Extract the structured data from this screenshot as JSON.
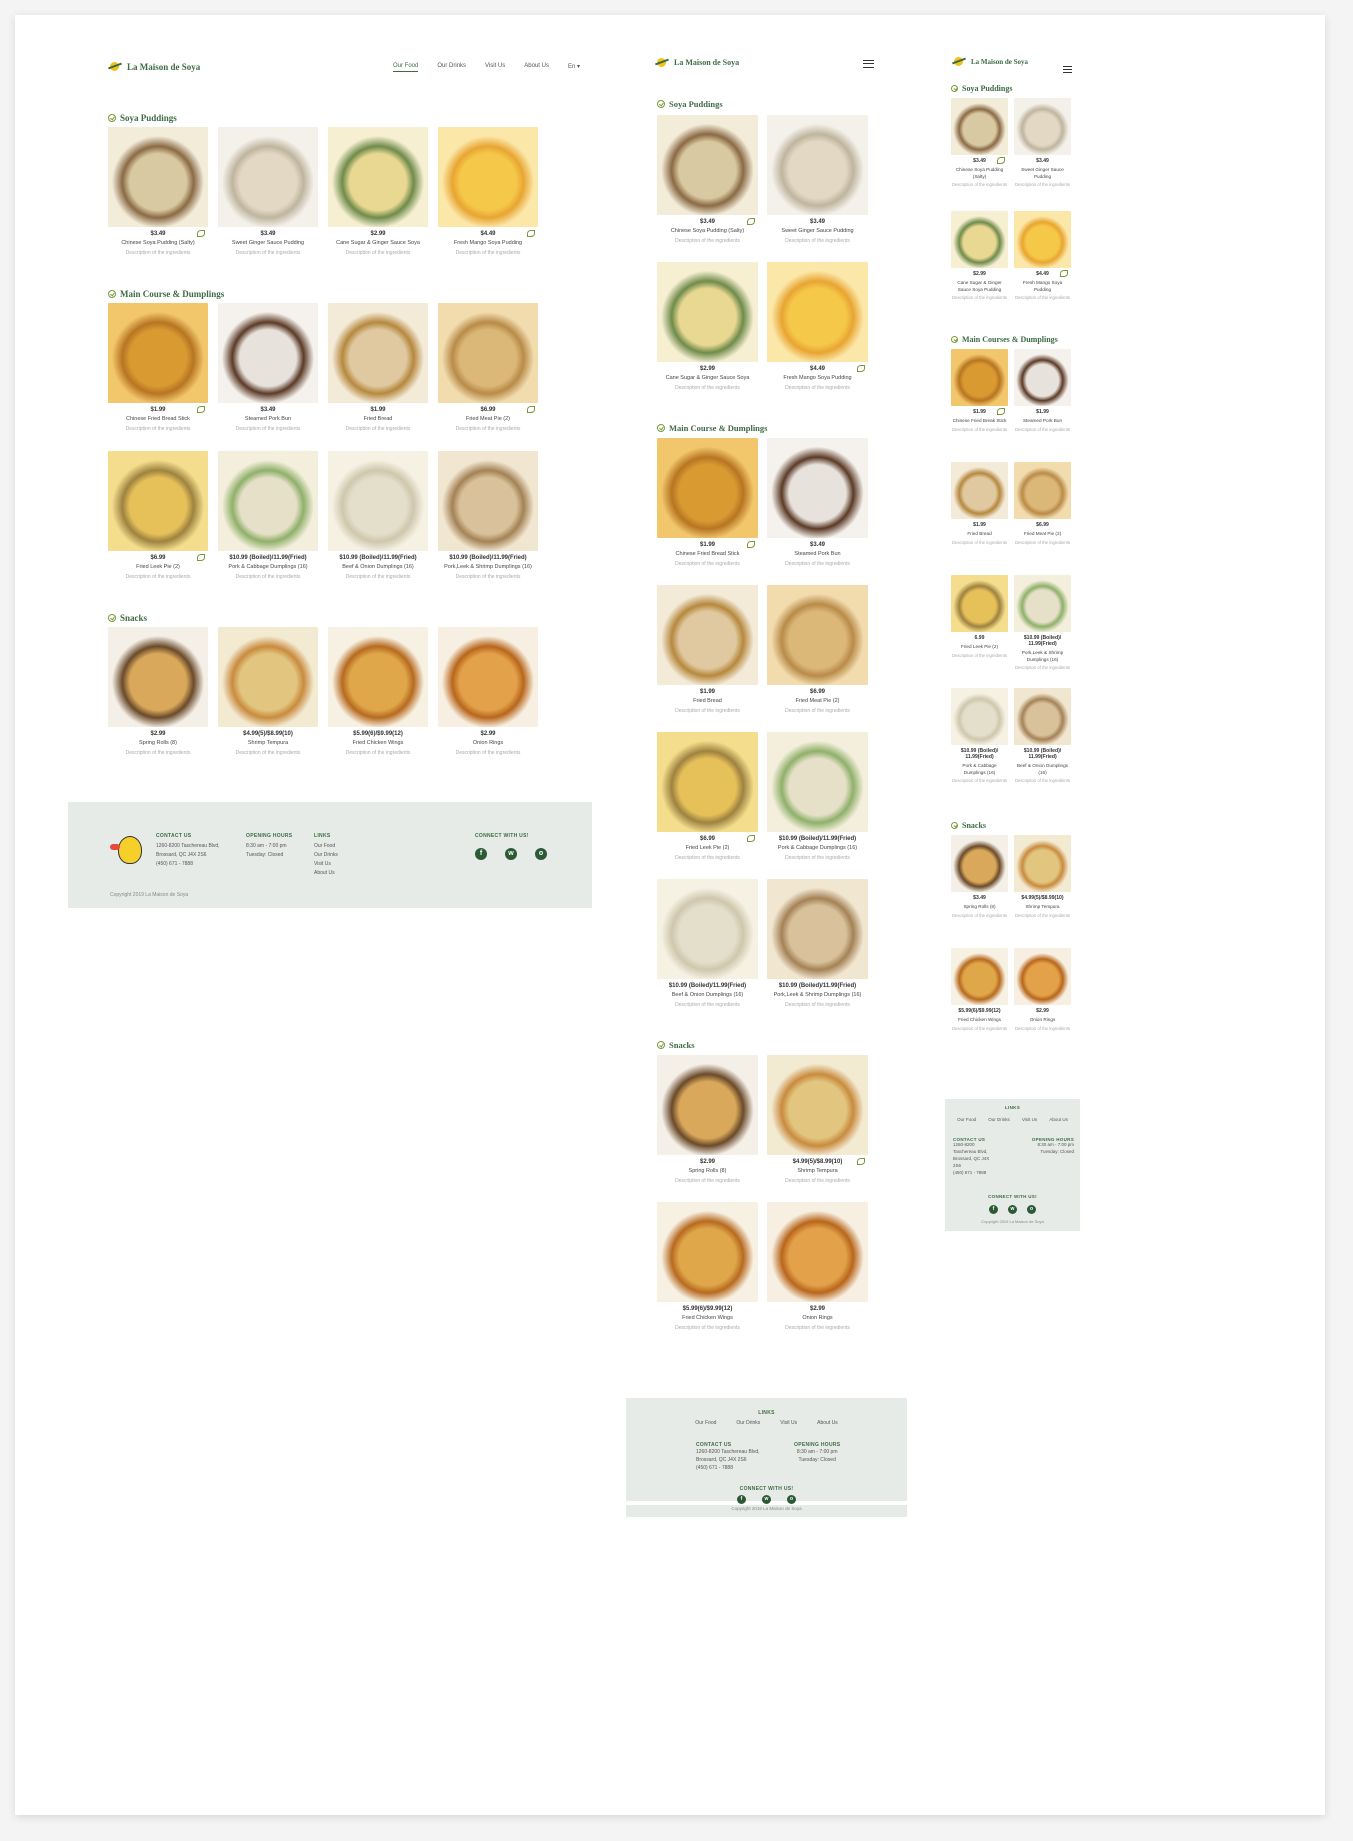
{
  "brand": "La Maison de Soya",
  "nav": [
    "Our Food",
    "Our Drinks",
    "Visit Us",
    "About Us",
    "En"
  ],
  "colors": {
    "brand_green": "#3d6b45",
    "footer_bg": "#e6ebe7",
    "accent_leaf": "#7a9a3a"
  },
  "desc": "Description of the ingredients",
  "desktop": {
    "sections": [
      {
        "title": "Soya Puddings",
        "items": [
          {
            "price": "$3.49",
            "name": "Chinese Soya Pudding (Salty)",
            "img": "salty-pudding",
            "leaf": true
          },
          {
            "price": "$3.49",
            "name": "Sweet Ginger Sauce Pudding",
            "img": "ginger-pudding",
            "leaf": false
          },
          {
            "price": "$2.99",
            "name": "Cane Sugar & Ginger Sauce Soya",
            "img": "cane-pudding",
            "leaf": false
          },
          {
            "price": "$4.49",
            "name": "Fresh Mango Soya Pudding",
            "img": "mango-pudding",
            "leaf": true
          }
        ]
      },
      {
        "title": "Main Course & Dumplings",
        "items": [
          {
            "price": "$1.99",
            "name": "Chinese Fried Bread Stick",
            "img": "bread-stick",
            "leaf": true
          },
          {
            "price": "$3.49",
            "name": "Steamed Pork Bun",
            "img": "pork-bun",
            "leaf": false
          },
          {
            "price": "$1.99",
            "name": "Fried Bread",
            "img": "fried-bread",
            "leaf": false
          },
          {
            "price": "$6.99",
            "name": "Fried Meat Pie (2)",
            "img": "meat-pie",
            "leaf": true
          },
          {
            "price": "$6.99",
            "name": "Fried Leek Pie (2)",
            "img": "leek-pie",
            "leaf": true
          },
          {
            "price": "$10.99 (Boiled)/11.99(Fried)",
            "name": "Pork & Cabbage Dumplings (16)",
            "img": "cabbage-dumplings",
            "leaf": false
          },
          {
            "price": "$10.99 (Boiled)/11.99(Fried)",
            "name": "Beef & Onion Dumplings (16)",
            "img": "beef-dumplings",
            "leaf": false
          },
          {
            "price": "$10.99 (Boiled)/11.99(Fried)",
            "name": "Pork,Leek & Shrimp Dumplings (16)",
            "img": "shrimp-dumplings",
            "leaf": false
          }
        ]
      },
      {
        "title": "Snacks",
        "items": [
          {
            "price": "$2.99",
            "name": "Spring Rolls (8)",
            "img": "spring-rolls",
            "leaf": false
          },
          {
            "price": "$4.99(5)/$8.99(10)",
            "name": "Shrimp Tempura",
            "img": "tempura",
            "leaf": false
          },
          {
            "price": "$5.99(6)/$9.99(12)",
            "name": "Fried Chicken Wings",
            "img": "chicken-wings",
            "leaf": false
          },
          {
            "price": "$2.99",
            "name": "Onion Rings",
            "img": "onion-rings",
            "leaf": false
          }
        ]
      }
    ]
  },
  "tablet": {
    "sections": [
      {
        "title": "Soya Puddings",
        "items": [
          {
            "price": "$3.49",
            "name": "Chinese Soya Pudding (Salty)",
            "img": "salty-pudding",
            "leaf": true
          },
          {
            "price": "$3.49",
            "name": "Sweet Ginger Sauce Pudding",
            "img": "ginger-pudding",
            "leaf": false
          },
          {
            "price": "$2.99",
            "name": "Cane Sugar & Ginger Sauce Soya",
            "img": "cane-pudding",
            "leaf": false
          },
          {
            "price": "$4.49",
            "name": "Fresh Mango Soya Pudding",
            "img": "mango-pudding",
            "leaf": true
          }
        ]
      },
      {
        "title": "Main Course & Dumplings",
        "items": [
          {
            "price": "$1.99",
            "name": "Chinese Fried Bread Stick",
            "img": "bread-stick",
            "leaf": true
          },
          {
            "price": "$3.49",
            "name": "Steamed Pork Bun",
            "img": "pork-bun",
            "leaf": false
          },
          {
            "price": "$1.99",
            "name": "Fried Bread",
            "img": "fried-bread",
            "leaf": false
          },
          {
            "price": "$6.99",
            "name": "Fried Meat Pie (2)",
            "img": "meat-pie",
            "leaf": false
          },
          {
            "price": "$6.99",
            "name": "Fried Leek Pie (2)",
            "img": "leek-pie",
            "leaf": true
          },
          {
            "price": "$10.99 (Boiled)/11.99(Fried)",
            "name": "Pork & Cabbage Dumplings (16)",
            "img": "cabbage-dumplings",
            "leaf": false
          },
          {
            "price": "$10.99 (Boiled)/11.99(Fried)",
            "name": "Beef & Onion Dumplings (16)",
            "img": "beef-dumplings",
            "leaf": false
          },
          {
            "price": "$10.99 (Boiled)/11.99(Fried)",
            "name": "Pork,Leek & Shrimp Dumplings (16)",
            "img": "shrimp-dumplings",
            "leaf": false
          }
        ]
      },
      {
        "title": "Snacks",
        "items": [
          {
            "price": "$2.99",
            "name": "Spring Rolls (8)",
            "img": "spring-rolls",
            "leaf": false
          },
          {
            "price": "$4.99(5)/$8.99(10)",
            "name": "Shrimp Tempura",
            "img": "tempura",
            "leaf": true
          },
          {
            "price": "$5.99(6)/$9.99(12)",
            "name": "Fried Chicken Wings",
            "img": "chicken-wings",
            "leaf": false
          },
          {
            "price": "$2.99",
            "name": "Onion Rings",
            "img": "onion-rings",
            "leaf": false
          }
        ]
      }
    ]
  },
  "mobile": {
    "sections": [
      {
        "title": "Soya Puddings",
        "items": [
          {
            "price": "$3.49",
            "name": "Chinese Soya Pudding (Salty)",
            "img": "salty-pudding",
            "leaf": true
          },
          {
            "price": "$3.49",
            "name": "Sweet Ginger Sauce Pudding",
            "img": "ginger-pudding",
            "leaf": false
          },
          {
            "price": "$2.99",
            "name": "Cane Sugar & Ginger Sauce Soya Pudding",
            "img": "cane-pudding",
            "leaf": false
          },
          {
            "price": "$4.49",
            "name": "Fresh Mango Soya Pudding",
            "img": "mango-pudding",
            "leaf": true
          }
        ]
      },
      {
        "title": "Main Courses & Dumplings",
        "items": [
          {
            "price": "$1.99",
            "name": "Chinese Fried Break Stick",
            "img": "bread-stick",
            "leaf": true
          },
          {
            "price": "$1.99",
            "name": "Steamed Pork Bun",
            "img": "pork-bun",
            "leaf": false
          },
          {
            "price": "$1.99",
            "name": "Fried Bread",
            "img": "fried-bread",
            "leaf": false
          },
          {
            "price": "$6.99",
            "name": "Fried Meat Pie (2)",
            "img": "meat-pie",
            "leaf": false
          },
          {
            "price": "6.99",
            "name": "Fried Leek Pie (2)",
            "img": "leek-pie",
            "leaf": false
          },
          {
            "price": "$10.99 (Boiled)/ 11.99(Fried)",
            "name": "Pork,Leek & Shrimp Dumplings (16)",
            "img": "cabbage-dumplings",
            "leaf": false
          },
          {
            "price": "$10.99 (Boiled)/ 11.99(Fried)",
            "name": "Pork & Cabbage Dumplings (16)",
            "img": "beef-dumplings",
            "leaf": false
          },
          {
            "price": "$10.99 (Boiled)/ 11.99(Fried)",
            "name": "Beef & Onion Dumplings (16)",
            "img": "shrimp-dumplings",
            "leaf": false
          }
        ]
      },
      {
        "title": "Snacks",
        "items": [
          {
            "price": "$3.49",
            "name": "Spring Rolls (8)",
            "img": "spring-rolls",
            "leaf": false
          },
          {
            "price": "$4.99(5)/$8.99(10)",
            "name": "Shrimp Tempura",
            "img": "tempura",
            "leaf": false
          },
          {
            "price": "$5.99(6)/$9.99(12)",
            "name": "Fried Chicken Wings",
            "img": "chicken-wings",
            "leaf": false
          },
          {
            "price": "$2.99",
            "name": "Onion Rings",
            "img": "onion-rings",
            "leaf": false
          }
        ]
      }
    ]
  },
  "footer": {
    "contact_title": "CONTACT US",
    "contact_lines": [
      "1260-8200 Taschereau Blvd,",
      "Brossard, QC J4X 2S6",
      "(450) 671 - 7888"
    ],
    "contact_lines_mobile": [
      "1260-8200",
      "Taschereau Blvd,",
      "Brossard, QC J4X",
      "2S6",
      "(450) 671 - 7888"
    ],
    "hours_title": "OPENING HOURS",
    "hours_lines": [
      "8:30 am - 7:00 pm",
      "Tuesday: Closed"
    ],
    "links_title": "LINKS",
    "links": [
      "Our Food",
      "Our Drinks",
      "Visit Us",
      "About Us"
    ],
    "connect_title": "CONNECT WITH US!",
    "social_icons": [
      "facebook-icon",
      "wechat-icon",
      "instagram-icon"
    ],
    "social_glyphs": [
      "f",
      "w",
      "o"
    ],
    "copyright": "Copyright 2019 La Maison de Soya"
  }
}
